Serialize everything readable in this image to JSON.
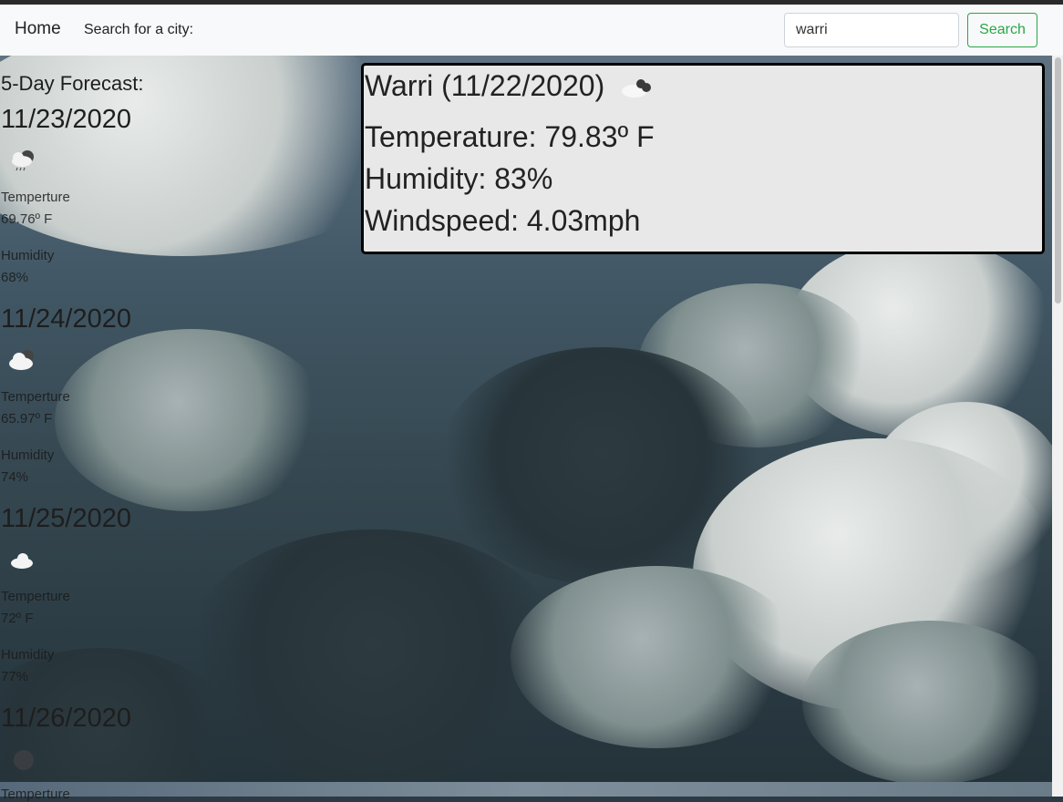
{
  "nav": {
    "brand": "Home",
    "search_label": "Search for a city:",
    "search_value": "warri",
    "search_button": "Search"
  },
  "forecast": {
    "title": "5-Day Forecast:",
    "temp_label": "Temperture",
    "humidity_label": "Humidity",
    "days": [
      {
        "date": "11/23/2020",
        "temp": "69.76º F",
        "humidity": "68%",
        "icon": "light-rain-cloud-icon"
      },
      {
        "date": "11/24/2020",
        "temp": "65.97º F",
        "humidity": "74%",
        "icon": "broken-clouds-icon"
      },
      {
        "date": "11/25/2020",
        "temp": "72º F",
        "humidity": "77%",
        "icon": "scattered-clouds-icon"
      },
      {
        "date": "11/26/2020",
        "temp": "",
        "humidity": "",
        "icon": "cloud-icon"
      }
    ],
    "last_temp_label": "Temperture"
  },
  "current": {
    "title": "Warri (11/22/2020)",
    "icon": "broken-clouds-icon",
    "temperature": "Temperature: 79.83º F",
    "humidity": "Humidity: 83%",
    "windspeed": "Windspeed: 4.03mph"
  },
  "colors": {
    "navbar_bg": "#f8f9fa",
    "search_button": "#28a745",
    "current_card_bg": "#e8e8e8",
    "current_card_border": "#000000"
  }
}
